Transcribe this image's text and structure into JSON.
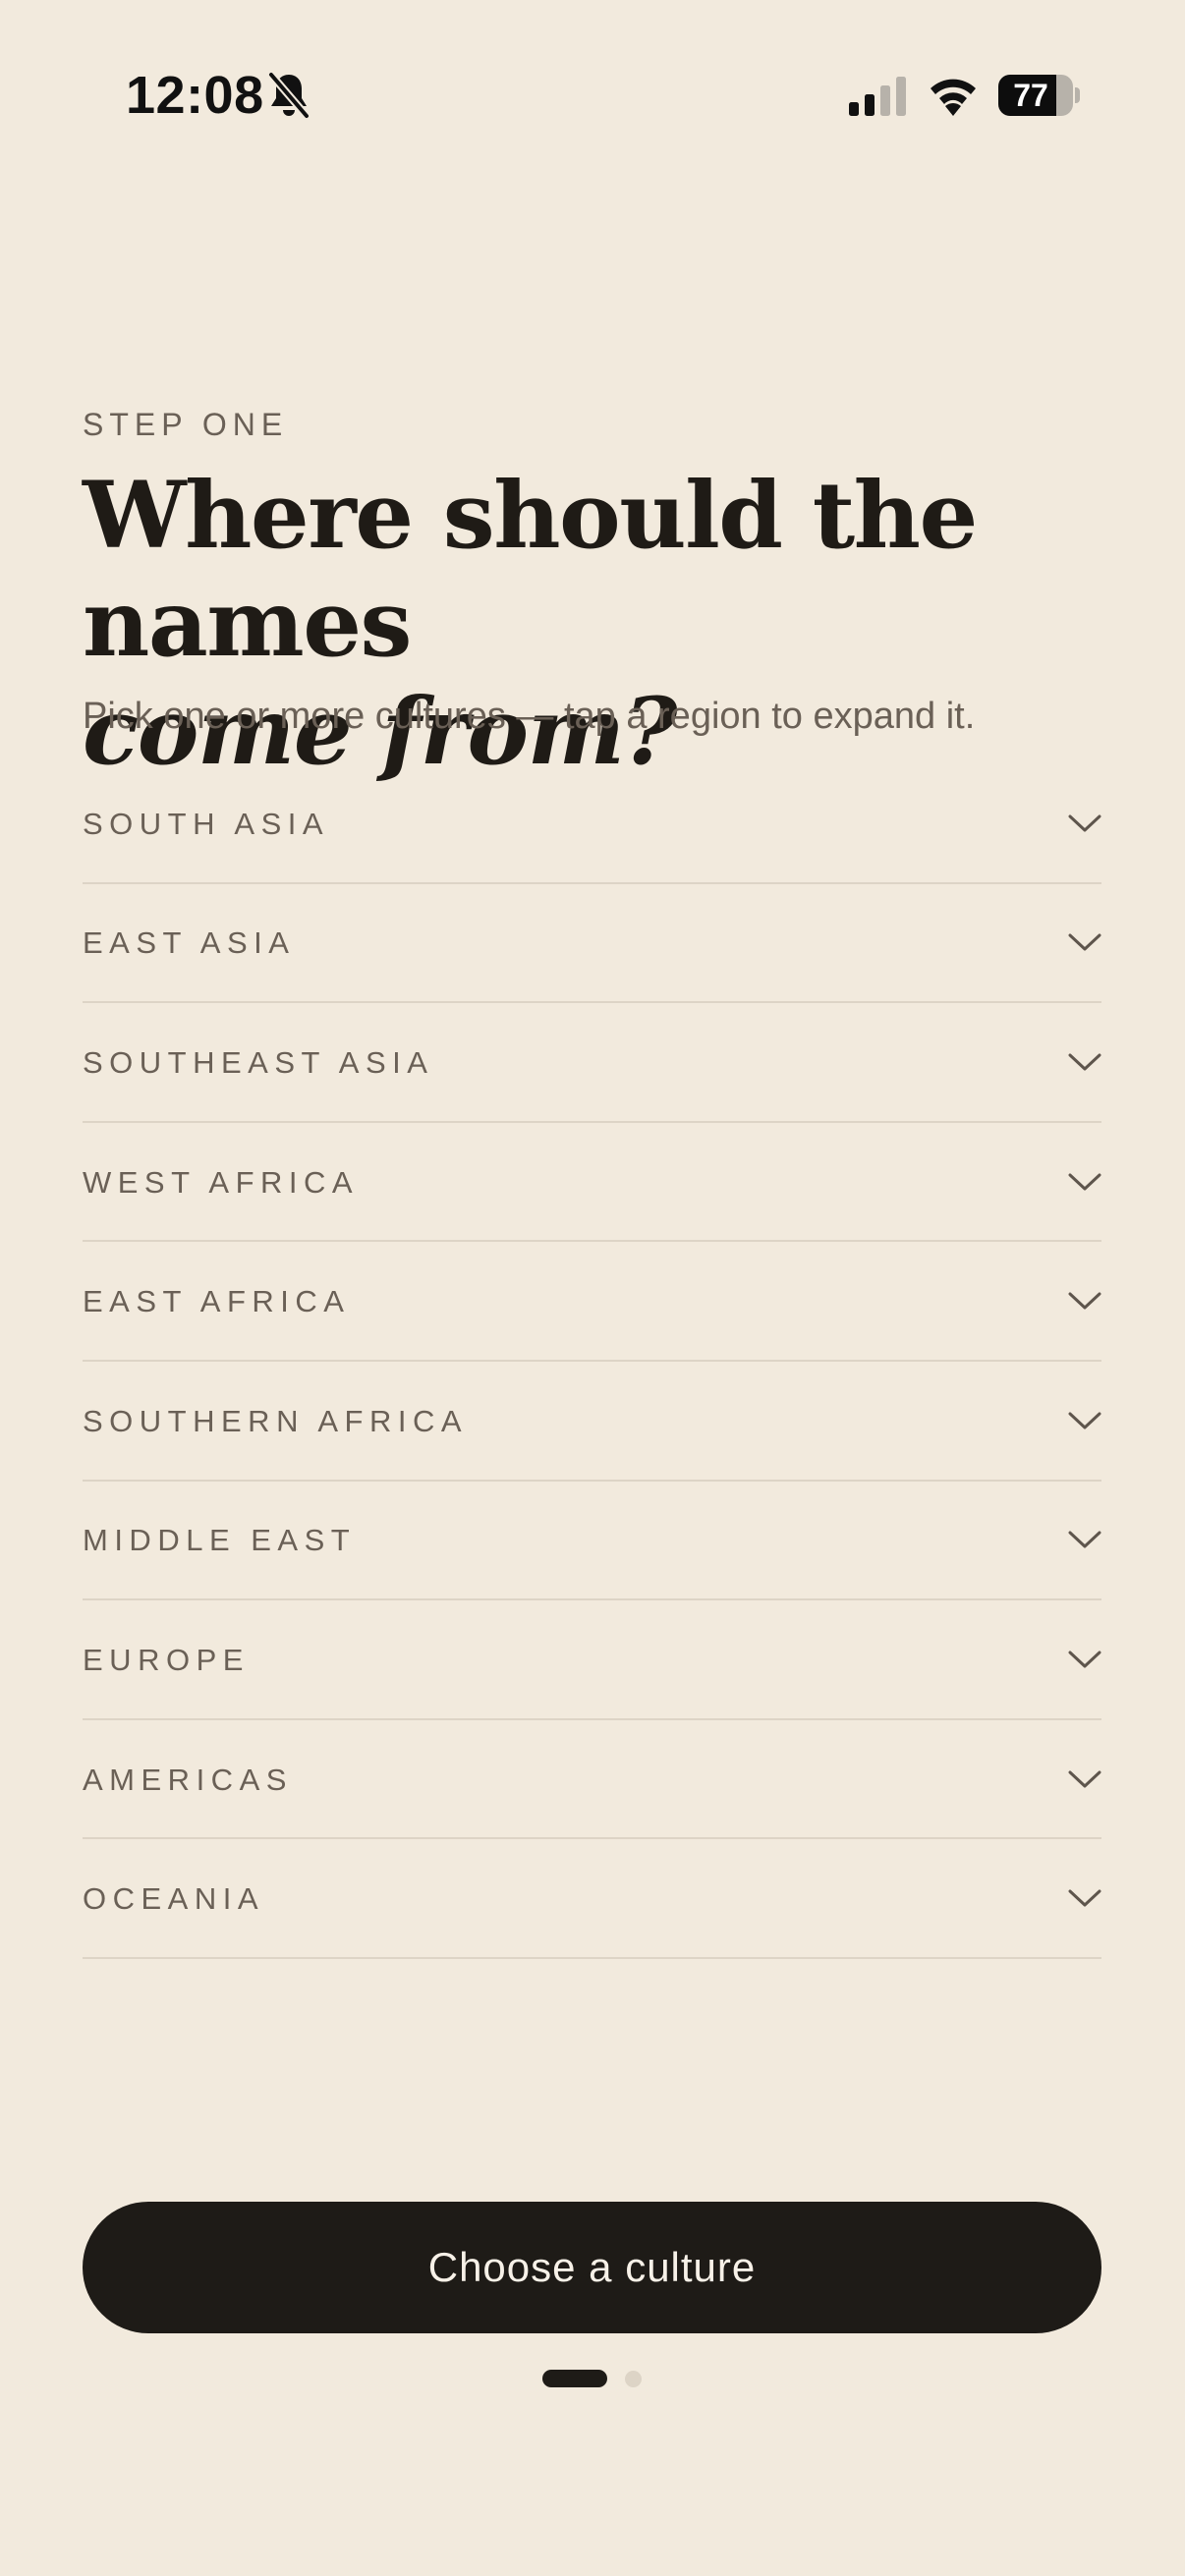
{
  "status_bar": {
    "time": "12:08",
    "battery_level": 77,
    "battery_text": "77",
    "icons": [
      "bell-slash-icon",
      "cellular-signal-icon",
      "wifi-icon",
      "battery-icon"
    ]
  },
  "header": {
    "step_label": "STEP ONE",
    "headline_line1": "Where should the names",
    "headline_line2": "come from?",
    "subtitle": "Pick one or more cultures — tap a region to expand it."
  },
  "regions": [
    {
      "label": "SOUTH ASIA",
      "icon": "chevron-down-icon"
    },
    {
      "label": "EAST ASIA",
      "icon": "chevron-down-icon"
    },
    {
      "label": "SOUTHEAST ASIA",
      "icon": "chevron-down-icon"
    },
    {
      "label": "WEST AFRICA",
      "icon": "chevron-down-icon"
    },
    {
      "label": "EAST AFRICA",
      "icon": "chevron-down-icon"
    },
    {
      "label": "SOUTHERN AFRICA",
      "icon": "chevron-down-icon"
    },
    {
      "label": "MIDDLE EAST",
      "icon": "chevron-down-icon"
    },
    {
      "label": "EUROPE",
      "icon": "chevron-down-icon"
    },
    {
      "label": "AMERICAS",
      "icon": "chevron-down-icon"
    },
    {
      "label": "OCEANIA",
      "icon": "chevron-down-icon"
    }
  ],
  "footer": {
    "cta_label": "Choose a culture",
    "page_indicator": {
      "current": 1,
      "total": 2
    }
  },
  "colors": {
    "background": "#f2eadd",
    "text_primary": "#1f1b16",
    "text_secondary": "#6a6056",
    "divider": "#ddd4c6",
    "button": "#1e1b17"
  }
}
